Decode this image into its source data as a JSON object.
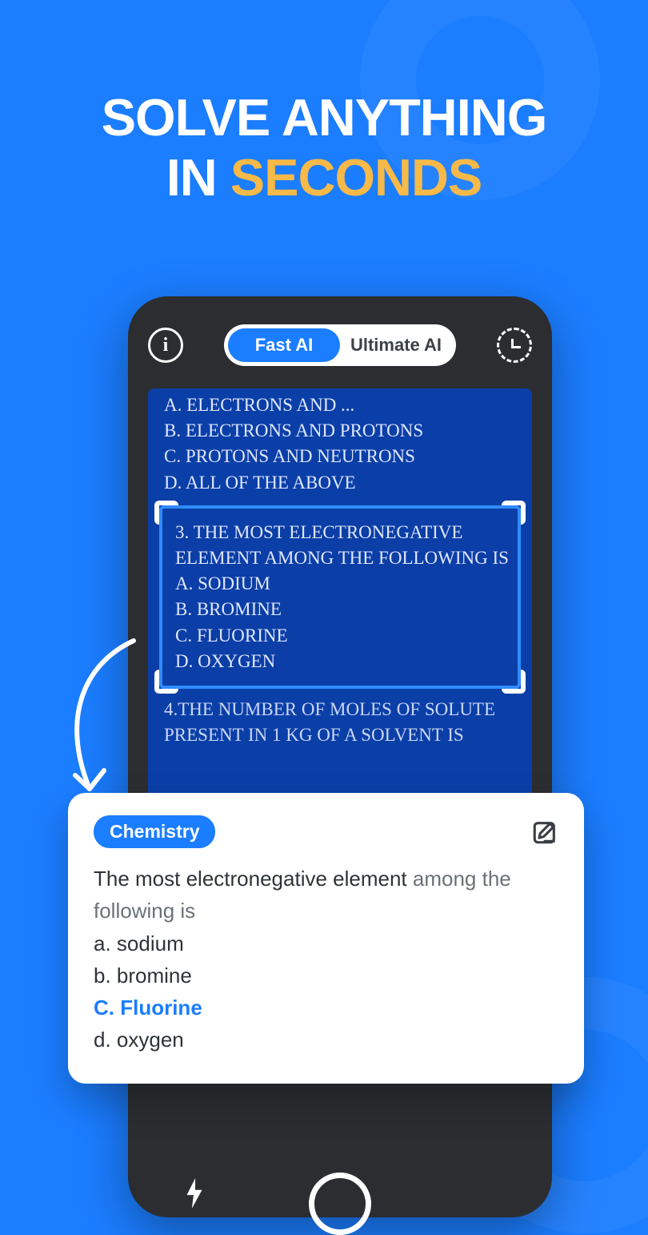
{
  "headline": {
    "line1": "SOLVE ANYTHING",
    "line2_prefix": "IN ",
    "line2_accent": "SECONDS"
  },
  "topbar": {
    "fast_label": "Fast AI",
    "ultimate_label": "Ultimate AI"
  },
  "scan": {
    "pre": [
      "A. ELECTRONS AND ...",
      "B. ELECTRONS AND PROTONS",
      "C. PROTONS AND NEUTRONS",
      "D. ALL OF THE ABOVE"
    ],
    "crop": [
      "3. THE MOST ELECTRONEGATIVE",
      "ELEMENT AMONG THE FOLLOWING IS",
      "A. SODIUM",
      "B. BROMINE",
      "C. FLUORINE",
      "D. OXYGEN"
    ],
    "post": [
      "4.THE NUMBER OF MOLES OF SOLUTE",
      "PRESENT IN 1 KG OF A SOLVENT IS"
    ]
  },
  "card": {
    "badge": "Chemistry",
    "question_part1": "The most electronegative element ",
    "question_part2": "among the following is",
    "opt_a": "a. sodium",
    "opt_b": "b. bromine",
    "opt_c": "C. Fluorine",
    "opt_d": "d. oxygen"
  }
}
